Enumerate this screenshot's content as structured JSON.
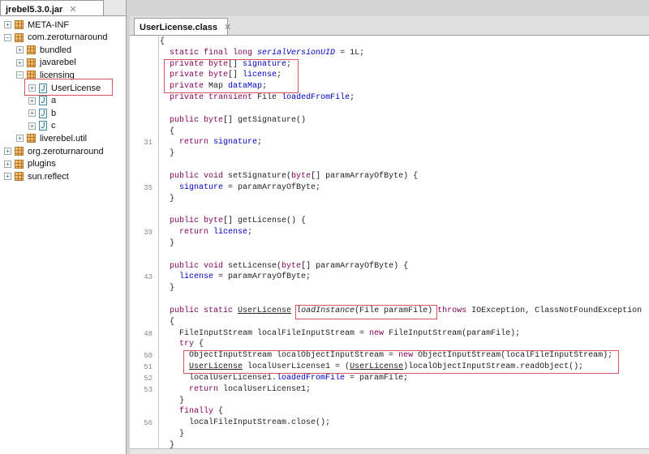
{
  "left_tab": {
    "label": "jrebel5.3.0.jar",
    "close": "✕"
  },
  "tree": [
    {
      "label": "META-INF",
      "type": "package",
      "level": 0,
      "expanded": false
    },
    {
      "label": "com.zeroturnaround",
      "type": "package",
      "level": 0,
      "expanded": true
    },
    {
      "label": "bundled",
      "type": "package",
      "level": 1,
      "expanded": false
    },
    {
      "label": "javarebel",
      "type": "package",
      "level": 1,
      "expanded": false
    },
    {
      "label": "licensing",
      "type": "package",
      "level": 1,
      "expanded": true
    },
    {
      "label": "UserLicense",
      "type": "class",
      "level": 2,
      "expanded": false
    },
    {
      "label": "a",
      "type": "class",
      "level": 2,
      "expanded": false
    },
    {
      "label": "b",
      "type": "class",
      "level": 2,
      "expanded": false
    },
    {
      "label": "c",
      "type": "class",
      "level": 2,
      "expanded": false
    },
    {
      "label": "liverebel.util",
      "type": "package",
      "level": 1,
      "expanded": false
    },
    {
      "label": "org.zeroturnaround",
      "type": "package",
      "level": 0,
      "expanded": false
    },
    {
      "label": "plugins",
      "type": "package",
      "level": 0,
      "expanded": false
    },
    {
      "label": "sun.reflect",
      "type": "package",
      "level": 0,
      "expanded": false
    }
  ],
  "editor_tab": {
    "label": "UserLicense.class",
    "close": "✕"
  },
  "code": [
    {
      "n": "",
      "t": [
        [
          "{",
          ""
        ]
      ]
    },
    {
      "n": "",
      "t": [
        [
          "  ",
          ""
        ],
        [
          "static final long ",
          "k"
        ],
        [
          "serialVersionUID",
          "fi"
        ],
        [
          " = 1L;",
          ""
        ]
      ]
    },
    {
      "n": "",
      "t": [
        [
          "  ",
          ""
        ],
        [
          "private byte",
          "k"
        ],
        [
          "[] ",
          ""
        ],
        [
          "signature",
          "f"
        ],
        [
          ";",
          ""
        ]
      ]
    },
    {
      "n": "",
      "t": [
        [
          "  ",
          ""
        ],
        [
          "private byte",
          "k"
        ],
        [
          "[] ",
          ""
        ],
        [
          "license",
          "f"
        ],
        [
          ";",
          ""
        ]
      ]
    },
    {
      "n": "",
      "t": [
        [
          "  ",
          ""
        ],
        [
          "private ",
          "k"
        ],
        [
          "Map ",
          ""
        ],
        [
          "dataMap",
          "f"
        ],
        [
          ";",
          ""
        ]
      ]
    },
    {
      "n": "",
      "t": [
        [
          "  ",
          ""
        ],
        [
          "private transient ",
          "k"
        ],
        [
          "File ",
          ""
        ],
        [
          "loadedFromFile",
          "f"
        ],
        [
          ";",
          ""
        ]
      ]
    },
    {
      "n": "",
      "t": []
    },
    {
      "n": "",
      "t": [
        [
          "  ",
          ""
        ],
        [
          "public byte",
          "k"
        ],
        [
          "[] getSignature()",
          ""
        ]
      ]
    },
    {
      "n": "",
      "t": [
        [
          "  {",
          ""
        ]
      ]
    },
    {
      "n": "31",
      "t": [
        [
          "    ",
          ""
        ],
        [
          "return ",
          "k"
        ],
        [
          "signature",
          "f"
        ],
        [
          ";",
          ""
        ]
      ]
    },
    {
      "n": "",
      "t": [
        [
          "  }",
          ""
        ]
      ]
    },
    {
      "n": "",
      "t": []
    },
    {
      "n": "",
      "t": [
        [
          "  ",
          ""
        ],
        [
          "public void ",
          "k"
        ],
        [
          "setSignature(",
          ""
        ],
        [
          "byte",
          "k"
        ],
        [
          "[] paramArrayOfByte) {",
          ""
        ]
      ]
    },
    {
      "n": "35",
      "t": [
        [
          "    ",
          ""
        ],
        [
          "signature",
          "f"
        ],
        [
          " = paramArrayOfByte;",
          ""
        ]
      ]
    },
    {
      "n": "",
      "t": [
        [
          "  }",
          ""
        ]
      ]
    },
    {
      "n": "",
      "t": []
    },
    {
      "n": "",
      "t": [
        [
          "  ",
          ""
        ],
        [
          "public byte",
          "k"
        ],
        [
          "[] getLicense() {",
          ""
        ]
      ]
    },
    {
      "n": "39",
      "t": [
        [
          "    ",
          ""
        ],
        [
          "return ",
          "k"
        ],
        [
          "license",
          "f"
        ],
        [
          ";",
          ""
        ]
      ]
    },
    {
      "n": "",
      "t": [
        [
          "  }",
          ""
        ]
      ]
    },
    {
      "n": "",
      "t": []
    },
    {
      "n": "",
      "t": [
        [
          "  ",
          ""
        ],
        [
          "public void ",
          "k"
        ],
        [
          "setLicense(",
          ""
        ],
        [
          "byte",
          "k"
        ],
        [
          "[] paramArrayOfByte) {",
          ""
        ]
      ]
    },
    {
      "n": "43",
      "t": [
        [
          "    ",
          ""
        ],
        [
          "license",
          "f"
        ],
        [
          " = paramArrayOfByte;",
          ""
        ]
      ]
    },
    {
      "n": "",
      "t": [
        [
          "  }",
          ""
        ]
      ]
    },
    {
      "n": "",
      "t": []
    },
    {
      "n": "",
      "t": [
        [
          "  ",
          ""
        ],
        [
          "public static ",
          "k"
        ],
        [
          "UserLicense",
          "u"
        ],
        [
          " ",
          ""
        ],
        [
          "loadInstance",
          "i"
        ],
        [
          "(File paramFile) ",
          ""
        ],
        [
          "throws ",
          "k"
        ],
        [
          "IOException, ClassNotFoundException",
          ""
        ]
      ]
    },
    {
      "n": "",
      "t": [
        [
          "  {",
          ""
        ]
      ]
    },
    {
      "n": "48",
      "t": [
        [
          "    FileInputStream localFileInputStream = ",
          ""
        ],
        [
          "new ",
          "k"
        ],
        [
          "FileInputStream(paramFile);",
          ""
        ]
      ]
    },
    {
      "n": "",
      "t": [
        [
          "    ",
          ""
        ],
        [
          "try ",
          "k"
        ],
        [
          "{",
          ""
        ]
      ]
    },
    {
      "n": "50",
      "t": [
        [
          "      ObjectInputStream localObjectInputStream = ",
          ""
        ],
        [
          "new ",
          "k"
        ],
        [
          "ObjectInputStream(localFileInputStream);",
          ""
        ]
      ]
    },
    {
      "n": "51",
      "t": [
        [
          "      ",
          ""
        ],
        [
          "UserLicense",
          "u"
        ],
        [
          " localUserLicense1 = (",
          ""
        ],
        [
          "UserLicense",
          "u"
        ],
        [
          ")localObjectInputStream.readObject();",
          ""
        ]
      ]
    },
    {
      "n": "52",
      "t": [
        [
          "      localUserLicense1.",
          ""
        ],
        [
          "loadedFromFile",
          "f"
        ],
        [
          " = paramFile;",
          ""
        ]
      ]
    },
    {
      "n": "53",
      "t": [
        [
          "      ",
          ""
        ],
        [
          "return ",
          "k"
        ],
        [
          "localUserLicense1;",
          ""
        ]
      ]
    },
    {
      "n": "",
      "t": [
        [
          "    }",
          ""
        ]
      ]
    },
    {
      "n": "",
      "t": [
        [
          "    ",
          ""
        ],
        [
          "finally ",
          "k"
        ],
        [
          "{",
          ""
        ]
      ]
    },
    {
      "n": "56",
      "t": [
        [
          "      localFileInputStream.close();",
          ""
        ]
      ]
    },
    {
      "n": "",
      "t": [
        [
          "    }",
          ""
        ]
      ]
    },
    {
      "n": "",
      "t": [
        [
          "  }",
          ""
        ]
      ]
    }
  ],
  "colors": {
    "highlight": "#d9545e",
    "keyword": "#7f0055",
    "field": "#0000c0"
  }
}
